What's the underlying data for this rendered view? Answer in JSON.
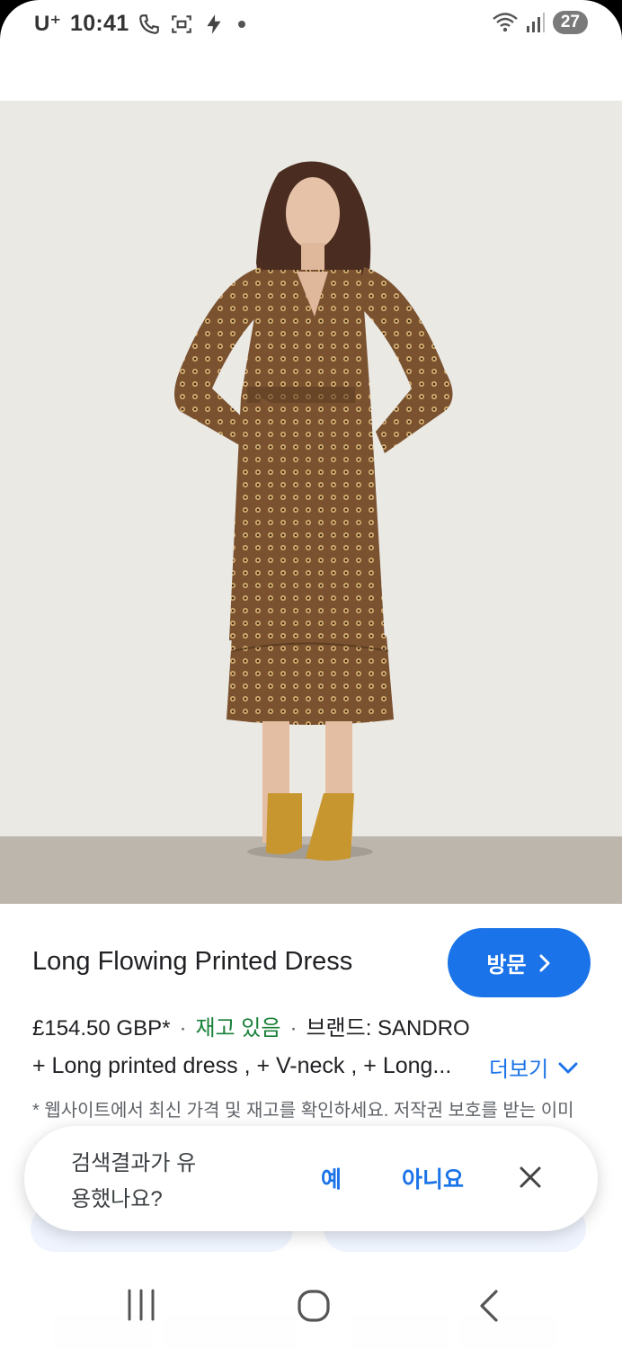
{
  "status_bar": {
    "carrier": "U⁺",
    "time": "10:41",
    "battery": "27"
  },
  "product": {
    "title": "Long Flowing Printed Dress",
    "visit_label": "방문",
    "price": "£154.50 GBP*",
    "stock": "재고 있음",
    "brand": "브랜드: SANDRO",
    "description": "+ Long printed dress , + V-neck , + Long...",
    "more_label": "더보기",
    "note": "* 웹사이트에서 최신 가격 및 재고를 확인하세요. 저작권 보호를 받는 이미"
  },
  "feedback": {
    "question": "검색결과가 유용했나요?",
    "yes_label": "예",
    "no_label": "아니요"
  },
  "icons": {
    "lens": "google-lens-icon",
    "close": "close-icon",
    "more": "chevron-down-icon",
    "visit": "chevron-right-icon"
  },
  "colors": {
    "accent": "#1a73e8",
    "in_stock": "#188038",
    "dress": "#7a5230"
  }
}
